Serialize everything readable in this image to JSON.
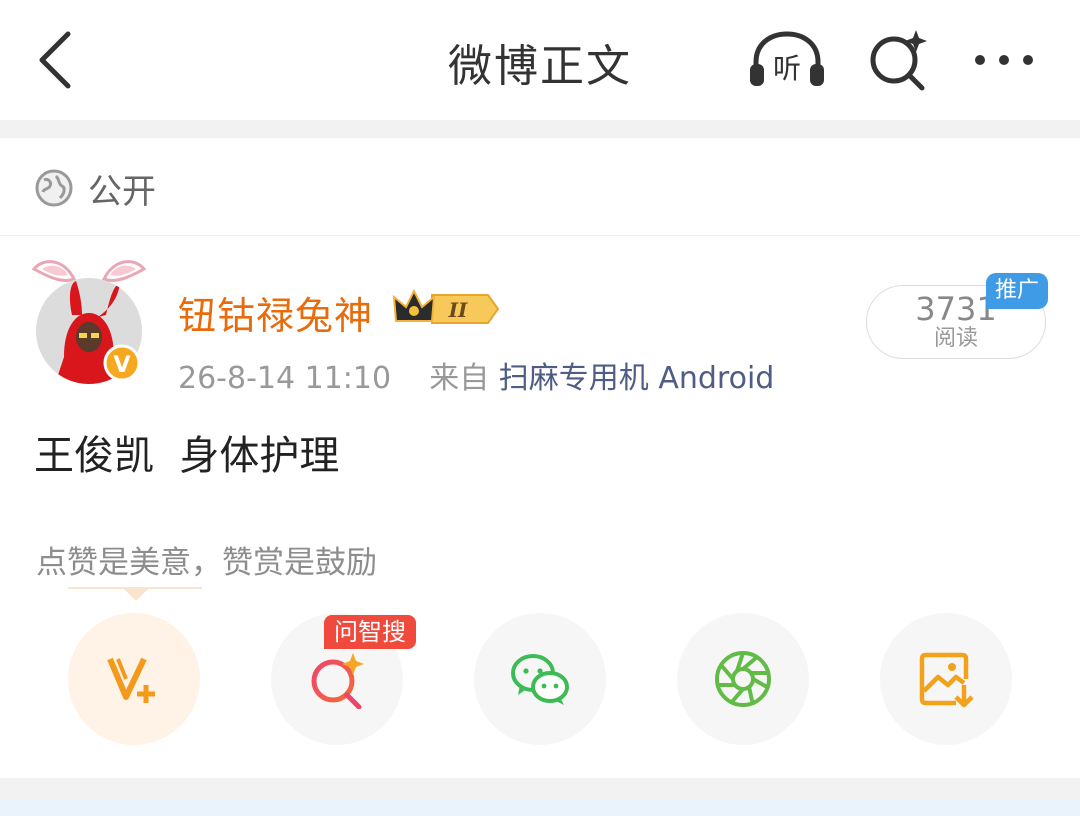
{
  "header": {
    "title": "微博正文",
    "listen_label": "听"
  },
  "visibility": {
    "label": "公开"
  },
  "post": {
    "author": "钮钴禄兔神",
    "vip_level": "II",
    "timestamp": "26-8-14 11:10",
    "source_prefix": "来自",
    "source": "扫麻专用机 Android",
    "read_count": "3731",
    "read_label": "阅读",
    "promo_badge": "推广",
    "content": "王俊凯  身体护理"
  },
  "reward_hint": "点赞是美意，赞赏是鼓励",
  "actions": {
    "ask_badge": "问智搜",
    "items": [
      "vplus-icon",
      "ai-search-icon",
      "wechat-icon",
      "moments-icon",
      "save-image-icon"
    ]
  },
  "colors": {
    "username": "#e86b0c",
    "source_link": "#4f5d85",
    "promo": "#3f9be6",
    "ask_badge": "#f04a3c",
    "vplus": "#f29a1b",
    "wechat": "#3dbb55",
    "moments": "#62bb46"
  }
}
